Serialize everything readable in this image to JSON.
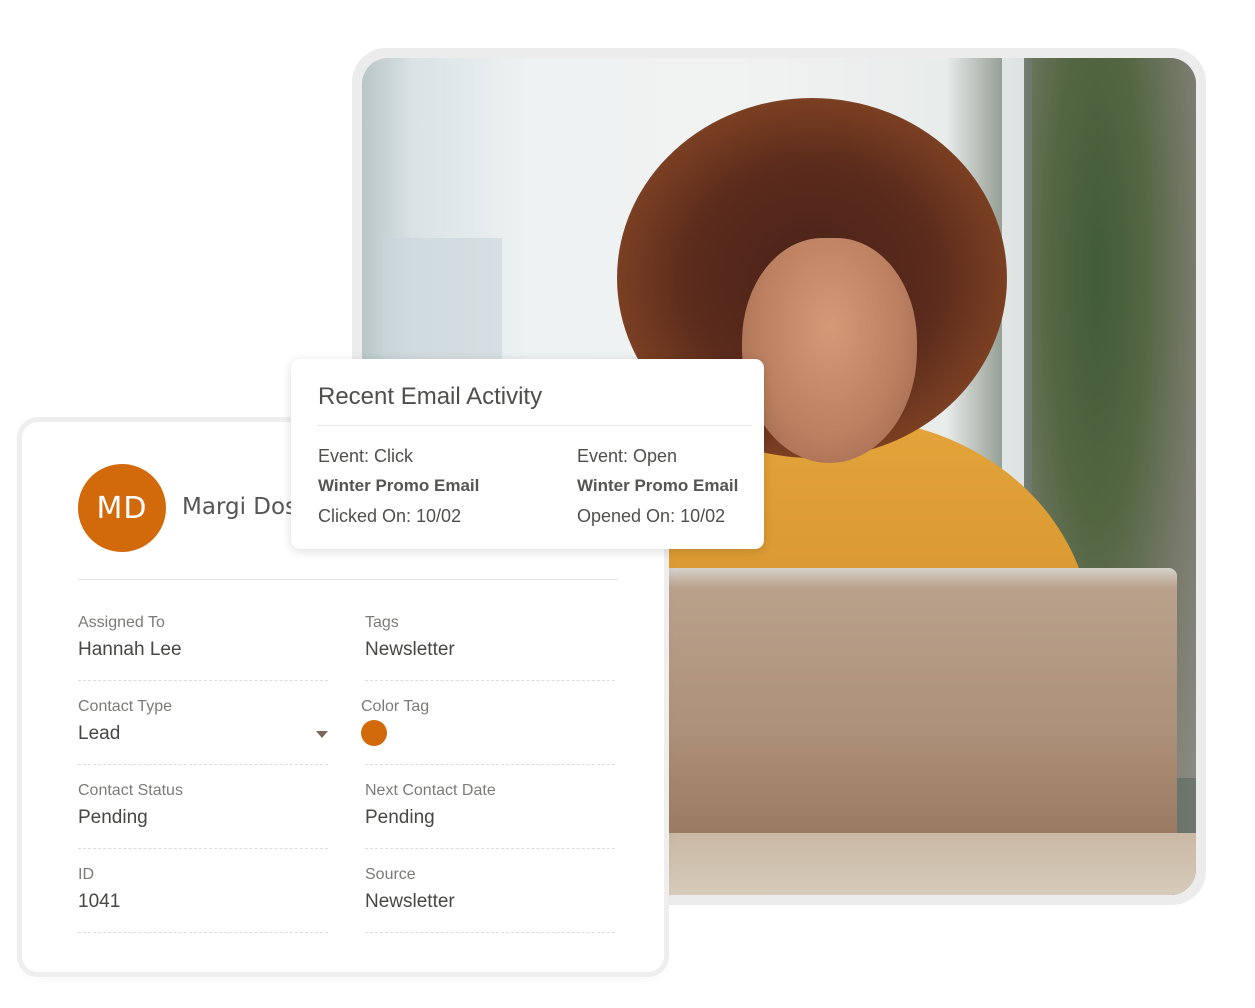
{
  "email_activity": {
    "title": "Recent Email Activity",
    "events": [
      {
        "event": "Event: Click",
        "email": "Winter Promo Email",
        "date": "Clicked On: 10/02"
      },
      {
        "event": "Event: Open",
        "email": "Winter Promo Email",
        "date": "Opened On: 10/02"
      }
    ]
  },
  "contact": {
    "initials": "MD",
    "name_visible": "Margi Dos",
    "avatar_color": "#d2690a",
    "fields": {
      "assigned_to": {
        "label": "Assigned To",
        "value": "Hannah Lee"
      },
      "tags": {
        "label": "Tags",
        "value": "Newsletter"
      },
      "contact_type": {
        "label": "Contact Type",
        "value": "Lead"
      },
      "color_tag": {
        "label": "Color Tag",
        "color": "#d2690a"
      },
      "contact_status": {
        "label": "Contact Status",
        "value": "Pending"
      },
      "next_contact_date": {
        "label": "Next Contact Date",
        "value": "Pending"
      },
      "id": {
        "label": "ID",
        "value": "1041"
      },
      "source": {
        "label": "Source",
        "value": "Newsletter"
      }
    }
  },
  "photo": {
    "description": "woman-with-curly-hair-smiling-at-laptop"
  }
}
